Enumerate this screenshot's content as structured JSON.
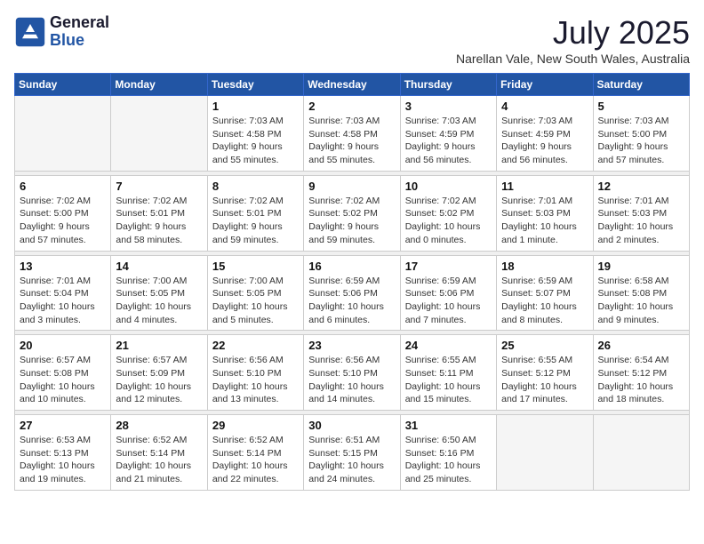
{
  "header": {
    "logo_line1": "General",
    "logo_line2": "Blue",
    "month": "July 2025",
    "location": "Narellan Vale, New South Wales, Australia"
  },
  "weekdays": [
    "Sunday",
    "Monday",
    "Tuesday",
    "Wednesday",
    "Thursday",
    "Friday",
    "Saturday"
  ],
  "weeks": [
    [
      {
        "day": "",
        "info": ""
      },
      {
        "day": "",
        "info": ""
      },
      {
        "day": "1",
        "info": "Sunrise: 7:03 AM\nSunset: 4:58 PM\nDaylight: 9 hours and 55 minutes."
      },
      {
        "day": "2",
        "info": "Sunrise: 7:03 AM\nSunset: 4:58 PM\nDaylight: 9 hours and 55 minutes."
      },
      {
        "day": "3",
        "info": "Sunrise: 7:03 AM\nSunset: 4:59 PM\nDaylight: 9 hours and 56 minutes."
      },
      {
        "day": "4",
        "info": "Sunrise: 7:03 AM\nSunset: 4:59 PM\nDaylight: 9 hours and 56 minutes."
      },
      {
        "day": "5",
        "info": "Sunrise: 7:03 AM\nSunset: 5:00 PM\nDaylight: 9 hours and 57 minutes."
      }
    ],
    [
      {
        "day": "6",
        "info": "Sunrise: 7:02 AM\nSunset: 5:00 PM\nDaylight: 9 hours and 57 minutes."
      },
      {
        "day": "7",
        "info": "Sunrise: 7:02 AM\nSunset: 5:01 PM\nDaylight: 9 hours and 58 minutes."
      },
      {
        "day": "8",
        "info": "Sunrise: 7:02 AM\nSunset: 5:01 PM\nDaylight: 9 hours and 59 minutes."
      },
      {
        "day": "9",
        "info": "Sunrise: 7:02 AM\nSunset: 5:02 PM\nDaylight: 9 hours and 59 minutes."
      },
      {
        "day": "10",
        "info": "Sunrise: 7:02 AM\nSunset: 5:02 PM\nDaylight: 10 hours and 0 minutes."
      },
      {
        "day": "11",
        "info": "Sunrise: 7:01 AM\nSunset: 5:03 PM\nDaylight: 10 hours and 1 minute."
      },
      {
        "day": "12",
        "info": "Sunrise: 7:01 AM\nSunset: 5:03 PM\nDaylight: 10 hours and 2 minutes."
      }
    ],
    [
      {
        "day": "13",
        "info": "Sunrise: 7:01 AM\nSunset: 5:04 PM\nDaylight: 10 hours and 3 minutes."
      },
      {
        "day": "14",
        "info": "Sunrise: 7:00 AM\nSunset: 5:05 PM\nDaylight: 10 hours and 4 minutes."
      },
      {
        "day": "15",
        "info": "Sunrise: 7:00 AM\nSunset: 5:05 PM\nDaylight: 10 hours and 5 minutes."
      },
      {
        "day": "16",
        "info": "Sunrise: 6:59 AM\nSunset: 5:06 PM\nDaylight: 10 hours and 6 minutes."
      },
      {
        "day": "17",
        "info": "Sunrise: 6:59 AM\nSunset: 5:06 PM\nDaylight: 10 hours and 7 minutes."
      },
      {
        "day": "18",
        "info": "Sunrise: 6:59 AM\nSunset: 5:07 PM\nDaylight: 10 hours and 8 minutes."
      },
      {
        "day": "19",
        "info": "Sunrise: 6:58 AM\nSunset: 5:08 PM\nDaylight: 10 hours and 9 minutes."
      }
    ],
    [
      {
        "day": "20",
        "info": "Sunrise: 6:57 AM\nSunset: 5:08 PM\nDaylight: 10 hours and 10 minutes."
      },
      {
        "day": "21",
        "info": "Sunrise: 6:57 AM\nSunset: 5:09 PM\nDaylight: 10 hours and 12 minutes."
      },
      {
        "day": "22",
        "info": "Sunrise: 6:56 AM\nSunset: 5:10 PM\nDaylight: 10 hours and 13 minutes."
      },
      {
        "day": "23",
        "info": "Sunrise: 6:56 AM\nSunset: 5:10 PM\nDaylight: 10 hours and 14 minutes."
      },
      {
        "day": "24",
        "info": "Sunrise: 6:55 AM\nSunset: 5:11 PM\nDaylight: 10 hours and 15 minutes."
      },
      {
        "day": "25",
        "info": "Sunrise: 6:55 AM\nSunset: 5:12 PM\nDaylight: 10 hours and 17 minutes."
      },
      {
        "day": "26",
        "info": "Sunrise: 6:54 AM\nSunset: 5:12 PM\nDaylight: 10 hours and 18 minutes."
      }
    ],
    [
      {
        "day": "27",
        "info": "Sunrise: 6:53 AM\nSunset: 5:13 PM\nDaylight: 10 hours and 19 minutes."
      },
      {
        "day": "28",
        "info": "Sunrise: 6:52 AM\nSunset: 5:14 PM\nDaylight: 10 hours and 21 minutes."
      },
      {
        "day": "29",
        "info": "Sunrise: 6:52 AM\nSunset: 5:14 PM\nDaylight: 10 hours and 22 minutes."
      },
      {
        "day": "30",
        "info": "Sunrise: 6:51 AM\nSunset: 5:15 PM\nDaylight: 10 hours and 24 minutes."
      },
      {
        "day": "31",
        "info": "Sunrise: 6:50 AM\nSunset: 5:16 PM\nDaylight: 10 hours and 25 minutes."
      },
      {
        "day": "",
        "info": ""
      },
      {
        "day": "",
        "info": ""
      }
    ]
  ]
}
